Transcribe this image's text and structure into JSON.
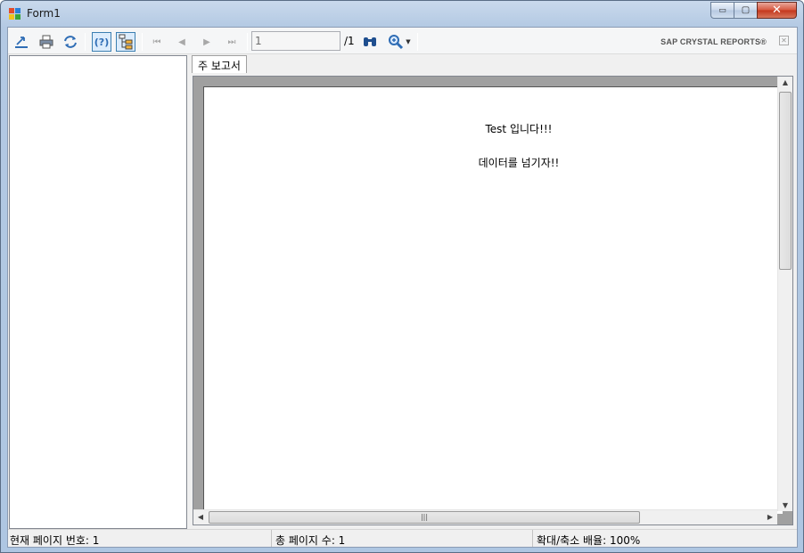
{
  "window": {
    "title": "Form1",
    "min_glyph": "▭",
    "max_glyph": "▢",
    "close_glyph": "✕"
  },
  "toolbar": {
    "export_icon": "export-icon",
    "print_icon": "print-icon",
    "refresh_icon": "refresh-icon",
    "help_icon": "help-icon",
    "help_glyph": "(?)",
    "group_tree_icon": "group-tree-icon",
    "first_page_glyph": "⏮",
    "prev_page_glyph": "◀",
    "next_page_glyph": "▶",
    "last_page_glyph": "⏭",
    "page_input_value": "1",
    "page_total": "/1",
    "search_icon": "binoculars-icon",
    "zoom_icon": "zoom-icon",
    "brand": "SAP CRYSTAL REPORTS®",
    "brand_close_glyph": "✕"
  },
  "tabs": [
    {
      "label": "주 보고서"
    }
  ],
  "report": {
    "line1": "Test 입니다!!!",
    "line2": "데이터를 넘기자!!"
  },
  "status": {
    "current_page": "현재 페이지 번호: 1",
    "total_pages": "총 페이지 수: 1",
    "zoom": "확대/축소 배율: 100%"
  },
  "colors": {
    "accent": "#2f6db5",
    "title_bar": "#b3c9e3",
    "close_button": "#c3361c"
  }
}
